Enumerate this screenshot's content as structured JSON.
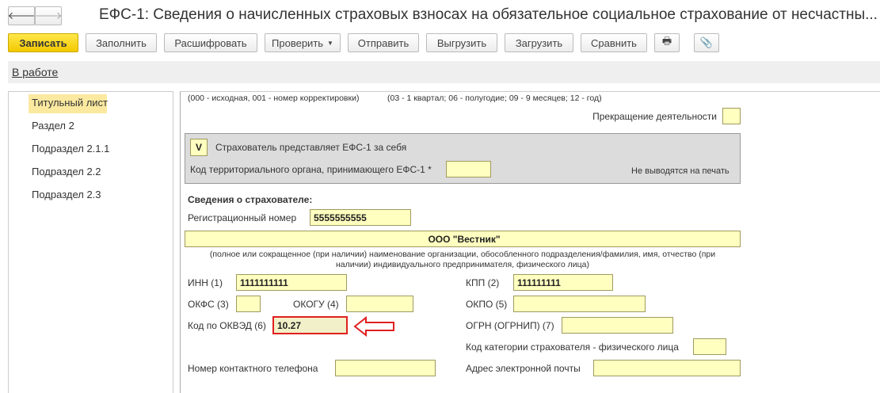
{
  "title": "ЕФС-1: Сведения о начисленных страховых взносах на обязательное социальное страхование от несчастны...",
  "toolbar": {
    "save": "Записать",
    "fill": "Заполнить",
    "decode": "Расшифровать",
    "check": "Проверить",
    "send": "Отправить",
    "upload": "Выгрузить",
    "load": "Загрузить",
    "compare": "Сравнить"
  },
  "status": "В работе",
  "sidebar": {
    "items": [
      {
        "label": "Титульный лист"
      },
      {
        "label": "Раздел 2"
      },
      {
        "label": "Подраздел 2.1.1"
      },
      {
        "label": "Подраздел 2.2"
      },
      {
        "label": "Подраздел 2.3"
      }
    ]
  },
  "form": {
    "hint1": "(000 - исходная, 001 - номер корректировки)",
    "hint2": "(03 - 1 квартал; 06 - полугодие; 09 - 9 месяцев; 12 - год)",
    "termination": "Прекращение деятельности",
    "self_mark": "V",
    "self_label": "Страхователь представляет ЕФС-1 за себя",
    "terr_label": "Код территориального органа, принимающего ЕФС-1 *",
    "no_print": "Не выводятся на печать",
    "insurer_heading": "Сведения о страхователе:",
    "reg_label": "Регистрационный номер",
    "reg_value": "5555555555",
    "org_name": "ООО \"Вестник\"",
    "org_caption1": "(полное или сокращенное (при наличии) наименование организации, обособленного подразделения/фамилия, имя, отчество (при",
    "org_caption2": "наличии) индивидуального предпринимателя, физического лица)",
    "inn_label": "ИНН (1)",
    "inn_value": "1111111111",
    "kpp_label": "КПП (2)",
    "kpp_value": "111111111",
    "okfs_label": "ОКФС (3)",
    "okogu_label": "ОКОГУ (4)",
    "okpo_label": "ОКПО (5)",
    "okved_label": "Код по ОКВЭД (6)",
    "okved_value": "10.27",
    "ogrn_label": "ОГРН (ОГРНИП) (7)",
    "category_label": "Код категории страхователя - физического лица",
    "phone_label": "Номер контактного телефона",
    "email_label": "Адрес электронной почты"
  }
}
